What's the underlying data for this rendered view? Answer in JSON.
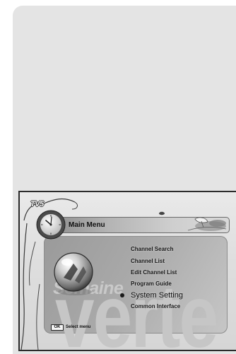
{
  "logo": {
    "text": "TV5"
  },
  "header": {
    "title": "Main Menu"
  },
  "menu": {
    "items": [
      {
        "label": "Channel Search",
        "selected": false
      },
      {
        "label": "Channel List",
        "selected": false
      },
      {
        "label": "Edit Channel List",
        "selected": false
      },
      {
        "label": "Program Guide",
        "selected": false
      },
      {
        "label": "System Setting",
        "selected": true
      },
      {
        "label": "Common Interface",
        "selected": false
      }
    ]
  },
  "watermark": {
    "line1": "Semaine",
    "line2": "verte"
  },
  "footer": {
    "key": "OK",
    "hint": "Select menu"
  },
  "icons": {
    "clock": "clock-icon",
    "menu_graphic": "sphere-icon",
    "header_art": "satellite-dish-icon",
    "selection": "bullet-icon"
  },
  "colors": {
    "page_bg": "#ffffff",
    "card_bg": "#e4e4e4",
    "frame_border": "#2b2b2b",
    "panel_bg": "#a9a9a9",
    "menu_text": "#151515",
    "watermark": "#c6c6c6"
  }
}
